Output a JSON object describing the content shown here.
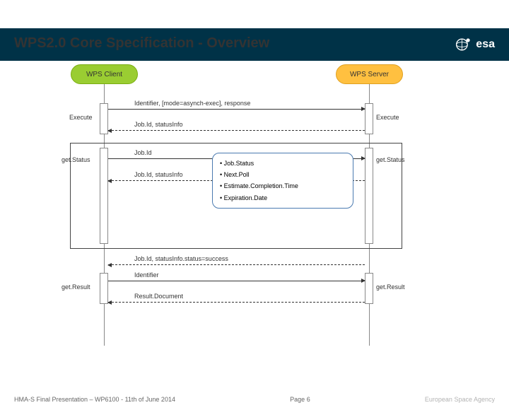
{
  "header": {
    "title": "WPS2.0 Core Specification - Overview",
    "logo_text": "esa"
  },
  "participants": {
    "client": "WPS Client",
    "server": "WPS Server"
  },
  "operations": {
    "execute_left": "Execute",
    "execute_right": "Execute",
    "getstatus_left": "get.Status",
    "getstatus_right": "get.Status",
    "getresult_left": "get.Result",
    "getresult_right": "get.Result"
  },
  "messages": {
    "m1": "Identifier, [mode=asynch-exec], response",
    "m2": "Job.Id, statusInfo",
    "m3": "Job.Id",
    "m4": "Job.Id, statusInfo",
    "m5": "Job.Id, statusInfo.status=success",
    "m6": "Identifier",
    "m7": "Result.Document"
  },
  "callout": {
    "items": [
      "Job.Status",
      "Next.Poll",
      "Estimate.Completion.Time",
      "Expiration.Date"
    ]
  },
  "footer": {
    "left": "HMA-S Final Presentation – WP6100 - 11th of June 2014",
    "page": "Page 6",
    "right": "European Space Agency"
  }
}
